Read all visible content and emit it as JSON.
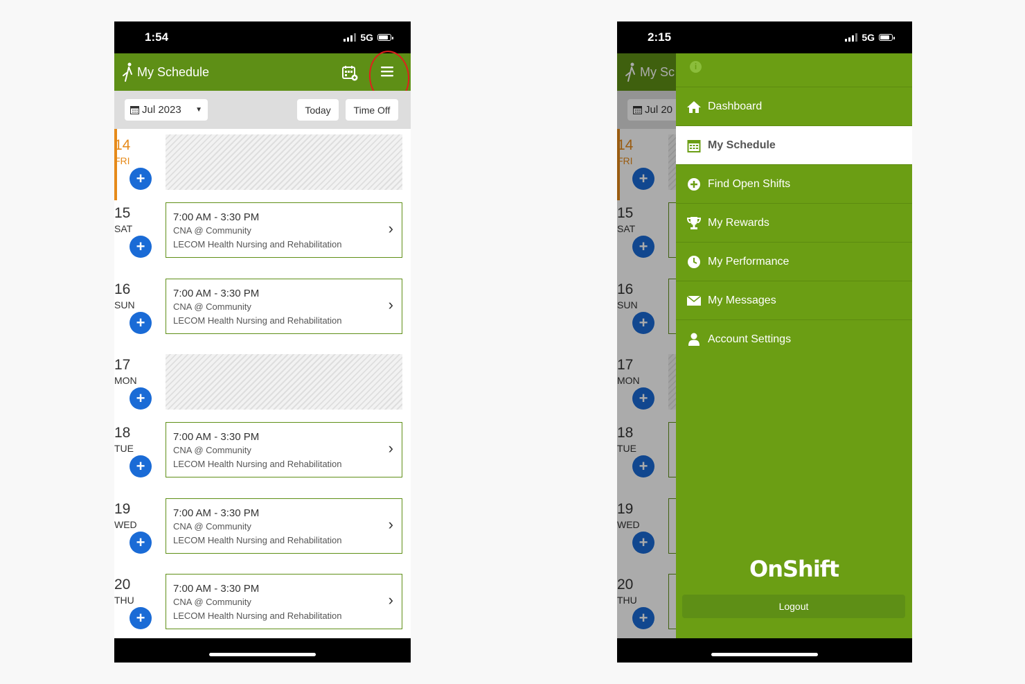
{
  "left_screen": {
    "status": {
      "time": "1:54",
      "network": "5G"
    },
    "header": {
      "title": "My Schedule"
    },
    "toolbar": {
      "month": "Jul 2023",
      "today_label": "Today",
      "timeoff_label": "Time Off"
    },
    "days": [
      {
        "num": "14",
        "name": "FRI",
        "today": true,
        "shift": null
      },
      {
        "num": "15",
        "name": "SAT",
        "shift": {
          "time": "7:00 AM - 3:30 PM",
          "role": "CNA @ Community",
          "location": "LECOM Health Nursing and Rehabilitation"
        }
      },
      {
        "num": "16",
        "name": "SUN",
        "shift": {
          "time": "7:00 AM - 3:30 PM",
          "role": "CNA @ Community",
          "location": "LECOM Health Nursing and Rehabilitation"
        }
      },
      {
        "num": "17",
        "name": "MON",
        "shift": null
      },
      {
        "num": "18",
        "name": "TUE",
        "shift": {
          "time": "7:00 AM - 3:30 PM",
          "role": "CNA @ Community",
          "location": "LECOM Health Nursing and Rehabilitation"
        }
      },
      {
        "num": "19",
        "name": "WED",
        "shift": {
          "time": "7:00 AM - 3:30 PM",
          "role": "CNA @ Community",
          "location": "LECOM Health Nursing and Rehabilitation"
        }
      },
      {
        "num": "20",
        "name": "THU",
        "shift": {
          "time": "7:00 AM - 3:30 PM",
          "role": "CNA @ Community",
          "location": "LECOM Health Nursing and Rehabilitation"
        }
      }
    ]
  },
  "right_screen": {
    "status": {
      "time": "2:15",
      "network": "5G"
    },
    "header": {
      "title_partial": "My Sc"
    },
    "toolbar": {
      "month_partial": "Jul 20"
    },
    "days": [
      {
        "num": "14",
        "name": "FRI",
        "today": true
      },
      {
        "num": "15",
        "name": "SAT"
      },
      {
        "num": "16",
        "name": "SUN"
      },
      {
        "num": "17",
        "name": "MON"
      },
      {
        "num": "18",
        "name": "TUE"
      },
      {
        "num": "19",
        "name": "WED"
      },
      {
        "num": "20",
        "name": "THU"
      }
    ],
    "menu": {
      "items": [
        {
          "label": "Dashboard",
          "icon": "home-icon"
        },
        {
          "label": "My Schedule",
          "icon": "calendar-icon",
          "active": true
        },
        {
          "label": "Find Open Shifts",
          "icon": "plus-circle-icon"
        },
        {
          "label": "My Rewards",
          "icon": "trophy-icon"
        },
        {
          "label": "My Performance",
          "icon": "clock-icon"
        },
        {
          "label": "My Messages",
          "icon": "envelope-icon"
        },
        {
          "label": "Account Settings",
          "icon": "user-icon"
        }
      ],
      "brand": "OnShift",
      "logout_label": "Logout"
    }
  },
  "colors": {
    "header_green": "#5e8f16",
    "drawer_green": "#6b9e14",
    "accent_orange": "#e68a1a",
    "add_button_blue": "#1a6bd6",
    "annotation_red": "#e0201c"
  }
}
